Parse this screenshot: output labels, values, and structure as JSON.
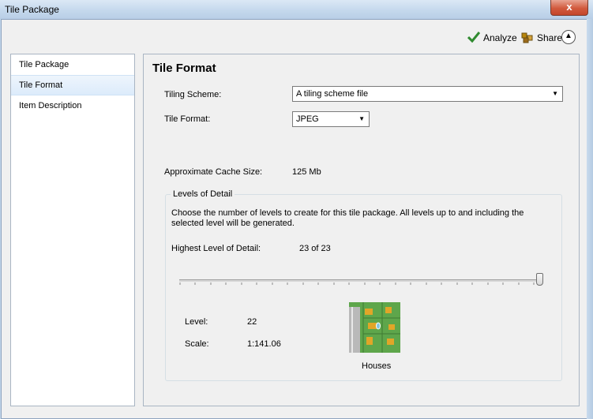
{
  "window": {
    "title": "Tile Package",
    "close_label": "x"
  },
  "toolbar": {
    "analyze_label": "Analyze",
    "share_label": "Share"
  },
  "nav": {
    "items": [
      "Tile Package",
      "Tile Format",
      "Item Description"
    ],
    "selected": "Tile Format"
  },
  "main": {
    "title": "Tile Format",
    "tiling_scheme_label": "Tiling Scheme:",
    "tiling_scheme_value": "A tiling scheme file",
    "tile_format_label": "Tile Format:",
    "tile_format_value": "JPEG",
    "cache_size_label": "Approximate Cache Size:",
    "cache_size_value": "125 Mb",
    "lod": {
      "group_title": "Levels of Detail",
      "description": "Choose the number of levels to create for this tile package.  All levels up to and including the selected level will be generated.",
      "highest_label": "Highest Level of Detail:",
      "highest_value": "23 of 23",
      "slider_level": 23,
      "slider_max": 23,
      "level_label": "Level:",
      "level_value": "22",
      "scale_label": "Scale:",
      "scale_value": "1:141.06",
      "preview_caption": "Houses"
    }
  },
  "colors": {
    "checkmark": "#2f8a2f",
    "accent": "#c3452a"
  }
}
